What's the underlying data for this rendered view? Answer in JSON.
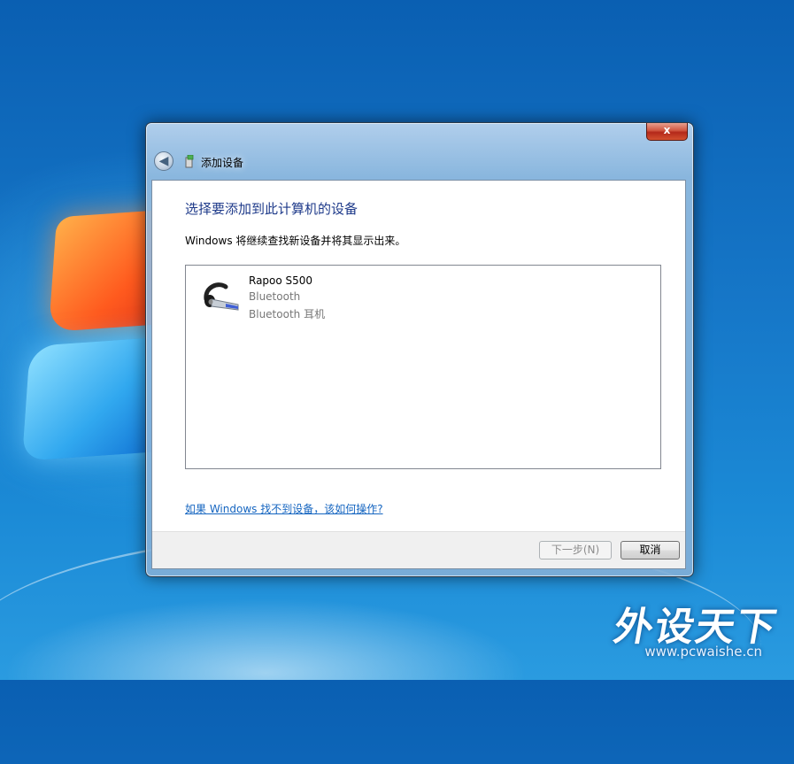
{
  "window": {
    "title": "添加设备",
    "close_label": "x",
    "back_label": "◀"
  },
  "content": {
    "heading": "选择要添加到此计算机的设备",
    "description": "Windows 将继续查找新设备并将其显示出来。",
    "devices": [
      {
        "name": "Rapoo S500",
        "type": "Bluetooth",
        "category": "Bluetooth 耳机",
        "icon": "headset-icon"
      }
    ],
    "help_link": "如果 Windows 找不到设备，该如何操作?"
  },
  "footer": {
    "next_label": "下一步(N)",
    "cancel_label": "取消"
  },
  "watermark": {
    "logo": "外设天下",
    "url": "www.pcwaishe.cn"
  }
}
